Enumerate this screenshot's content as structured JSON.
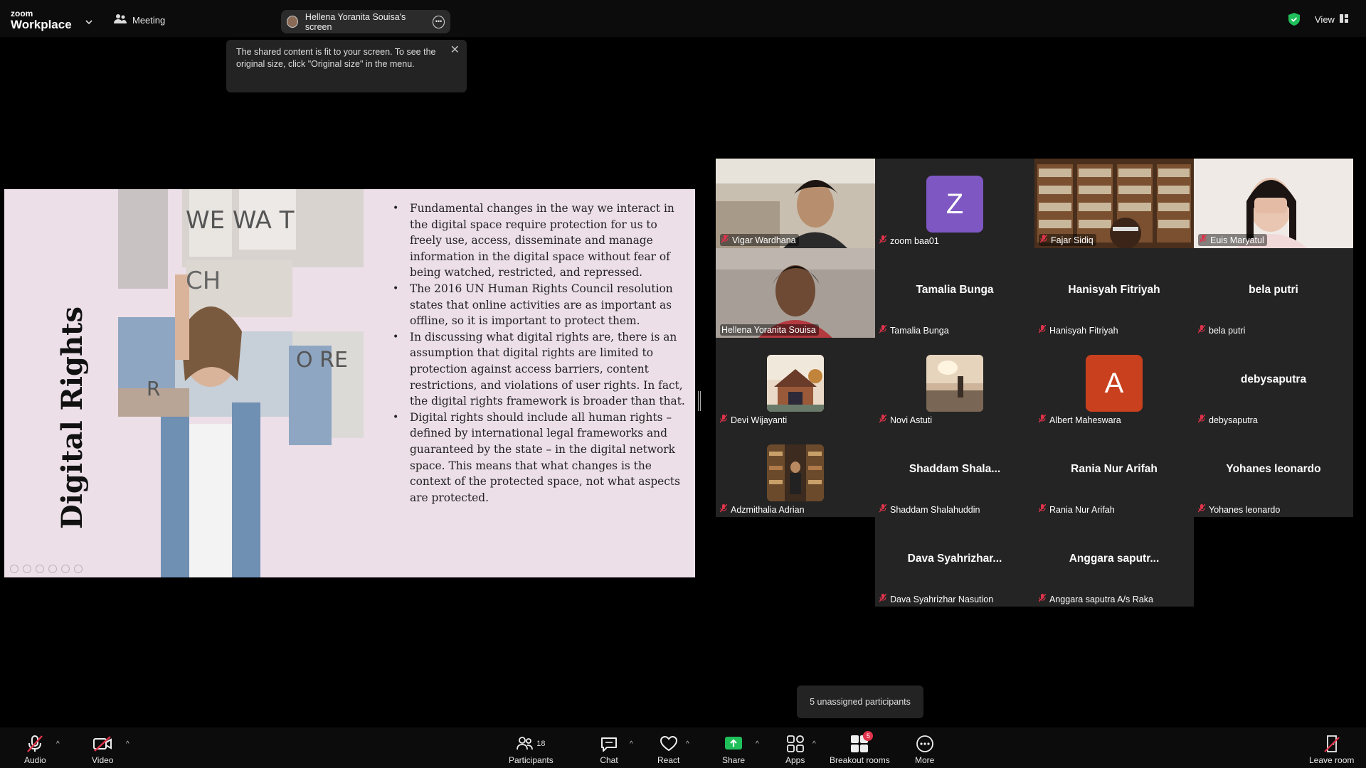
{
  "topbar": {
    "brand_small": "zoom",
    "brand_big": "Workplace",
    "meeting_label": "Meeting",
    "screen_pill_label": "Hellena Yoranita Souisa's screen",
    "view_label": "View"
  },
  "tooltip": {
    "text": "The shared content is fit to your screen. To see the original size, click \"Original size\" in the menu."
  },
  "slide": {
    "title": "Digital Rights",
    "bullets": [
      "Fundamental changes in the way we interact in the digital space require protection for us to freely use, access, disseminate and manage information in the digital space without fear of being watched, restricted, and repressed.",
      "The 2016 UN Human Rights Council resolution states that online activities are as important as offline, so it is important to protect them.",
      "In discussing what digital rights are, there is an assumption that digital rights are limited to protection against access barriers, content restrictions, and violations of user rights. In fact, the digital rights framework is broader than that.",
      "Digital rights should include all human rights – defined by international legal frameworks and guaranteed by the state – in the digital network space. This means that what changes is the context of the protected space, not what aspects are protected."
    ]
  },
  "participants": [
    {
      "label": "Vigar Wardhana",
      "display": "",
      "kind": "video"
    },
    {
      "label": "zoom baa01",
      "display": "Z",
      "kind": "initial",
      "color": "#7e57c2"
    },
    {
      "label": "Fajar Sidiq",
      "display": "",
      "kind": "video"
    },
    {
      "label": "Euis Maryatul",
      "display": "",
      "kind": "video"
    },
    {
      "label": "Hellena Yoranita Souisa",
      "display": "",
      "kind": "video",
      "active": true
    },
    {
      "label": "Tamalia Bunga",
      "display": "Tamalia Bunga",
      "kind": "name"
    },
    {
      "label": "Hanisyah Fitriyah",
      "display": "Hanisyah Fitriyah",
      "kind": "name"
    },
    {
      "label": "bela putri",
      "display": "bela putri",
      "kind": "name"
    },
    {
      "label": "Devi Wijayanti",
      "display": "",
      "kind": "photo"
    },
    {
      "label": "Novi Astuti",
      "display": "",
      "kind": "photo"
    },
    {
      "label": "Albert Maheswara",
      "display": "A",
      "kind": "initial",
      "color": "#c9401e"
    },
    {
      "label": "debysaputra",
      "display": "debysaputra",
      "kind": "name"
    },
    {
      "label": "Adzmithalia Adrian",
      "display": "",
      "kind": "photo"
    },
    {
      "label": "Shaddam Shalahuddin",
      "display": "Shaddam  Shala...",
      "kind": "name"
    },
    {
      "label": "Rania Nur Arifah",
      "display": "Rania Nur Arifah",
      "kind": "name"
    },
    {
      "label": "Yohanes leonardo",
      "display": "Yohanes leonardo",
      "kind": "name"
    },
    {
      "label": "Dava Syahrizhar Nasution",
      "display": "Dava  Syahrizhar...",
      "kind": "name"
    },
    {
      "label": "Anggara saputra A/s Raka",
      "display": "Anggara  saputr...",
      "kind": "name"
    }
  ],
  "unassigned": "5 unassigned participants",
  "toolbar": {
    "audio": "Audio",
    "video": "Video",
    "participants": "Participants",
    "participants_count": "18",
    "chat": "Chat",
    "react": "React",
    "share": "Share",
    "apps": "Apps",
    "breakout": "Breakout rooms",
    "breakout_badge": "5",
    "more": "More",
    "leave": "Leave room"
  },
  "colors": {
    "share_green": "#1fbf5a",
    "active_outline": "#2ecc8c",
    "muted_red": "#e0334b"
  }
}
